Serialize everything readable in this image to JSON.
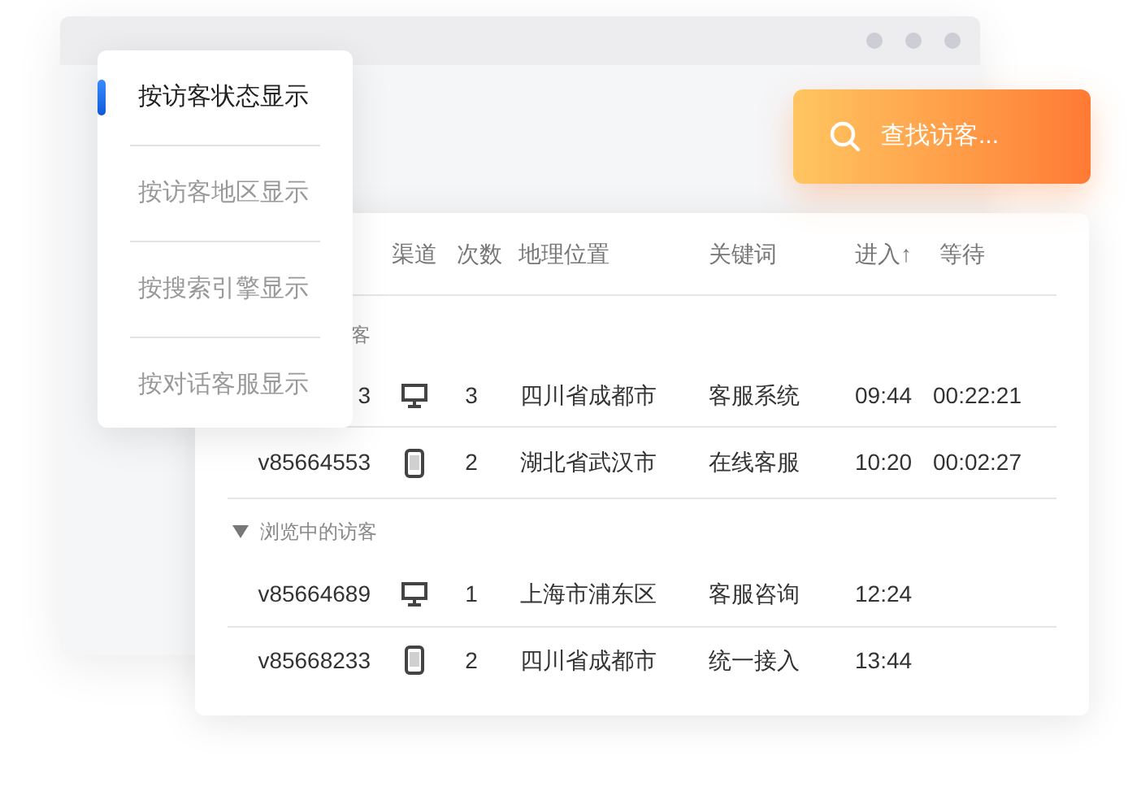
{
  "menu": [
    {
      "label": "按访客状态显示",
      "selected": true
    },
    {
      "label": "按访客地区显示",
      "selected": false
    },
    {
      "label": "按搜索引擎显示",
      "selected": false
    },
    {
      "label": "按对话客服显示",
      "selected": false
    }
  ],
  "search": {
    "label": "查找访客..."
  },
  "table": {
    "columns": [
      "渠道",
      "次数",
      "地理位置",
      "关键词",
      "进入↑",
      "等待"
    ],
    "groups": [
      {
        "kind": "partial",
        "label": "客",
        "rows": [
          {
            "visitor": "3",
            "kind": "desktop",
            "count": "3",
            "location": "四川省成都市",
            "keyword": "客服系统",
            "entered": "09:44",
            "wait": "00:22:21"
          },
          {
            "visitor": "v85664553",
            "kind": "mobile",
            "count": "2",
            "location": "湖北省武汉市",
            "keyword": "在线客服",
            "entered": "10:20",
            "wait": "00:02:27"
          }
        ]
      },
      {
        "kind": "full",
        "label": "浏览中的访客",
        "expanded": true,
        "rows": [
          {
            "visitor": "v85664689",
            "kind": "desktop",
            "count": "1",
            "location": "上海市浦东区",
            "keyword": "客服咨询",
            "entered": "12:24"
          },
          {
            "visitor": "v85668233",
            "kind": "mobile",
            "count": "2",
            "location": "四川省成都市",
            "keyword": "统一接入",
            "entered": "13:44"
          }
        ]
      }
    ]
  }
}
